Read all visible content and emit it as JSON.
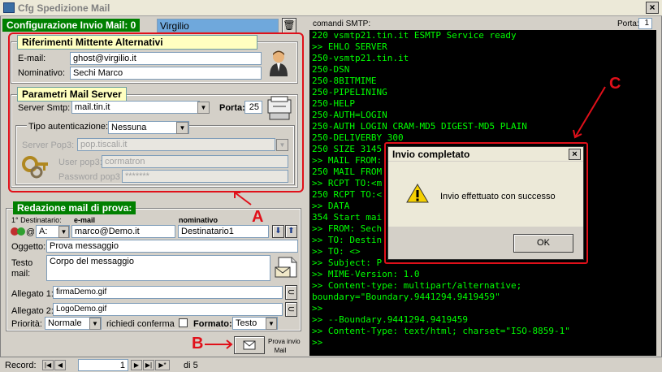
{
  "window": {
    "title": "Cfg Spedizione Mail",
    "close": "×"
  },
  "config": {
    "label": "Configurazione Invio Mail: 0",
    "name": "Virgilio"
  },
  "sender": {
    "header": "Riferimenti Mittente Alternativi",
    "email_label": "E-mail:",
    "email": "ghost@virgilio.it",
    "name_label": "Nominativo:",
    "name": "Sechi Marco"
  },
  "server": {
    "header": "Parametri Mail Server",
    "smtp_label": "Server Smtp:",
    "smtp": "mail.tin.it",
    "port_label": "Porta:",
    "port": "25",
    "auth_label": "Tipo autenticazione:",
    "auth": "Nessuna",
    "pop3_label": "Server Pop3:",
    "pop3": "pop.tiscali.it",
    "user_label": "User pop3:",
    "user": "cormatron",
    "pwd_label": "Password pop3",
    "pwd": "*******"
  },
  "compose": {
    "header": "Redazione mail di prova:",
    "dest_label": "1° Destinatario:",
    "email_col": "e-mail",
    "name_col": "nominativo",
    "type": "A:",
    "to": "marco@Demo.it",
    "to_name": "Destinatario1",
    "subject_label": "Oggetto:",
    "subject": "Prova messaggio",
    "body_label1": "Testo",
    "body_label2": "mail:",
    "body": "Corpo del messaggio",
    "att1_label": "Allegato 1:",
    "att1": "firmaDemo.gif",
    "att2_label": "Allegato 2:",
    "att2": "LogoDemo.gif",
    "priority_label": "Priorità:",
    "priority": "Normale",
    "confirm_label": "richiedi conferma",
    "format_label": "Formato:",
    "format": "Testo",
    "send_label1": "Prova invio",
    "send_label2": "Mail"
  },
  "record": {
    "label": "Record:",
    "current": "1",
    "total": "di 5"
  },
  "smtp_log": {
    "label": "comandi SMTP:",
    "port_label": "Porta:",
    "port": "1",
    "lines": [
      "220 vsmtp21.tin.it ESMTP Service ready",
      ">> EHLO SERVER",
      "250-vsmtp21.tin.it",
      "250-DSN",
      "250-8BITMIME",
      "250-PIPELINING",
      "250-HELP",
      "250-AUTH=LOGIN",
      "250-AUTH LOGIN CRAM-MD5 DIGEST-MD5 PLAIN",
      "250-DELIVERBY 300",
      "250 SIZE 3145",
      ">> MAIL FROM:",
      "250 MAIL FROM",
      ">> RCPT TO:<m",
      "250 RCPT TO:<",
      ">> DATA",
      "354 Start mai",
      ">> FROM: Sech",
      ">> TO: Destin",
      ">> TO:  <>",
      ">> Subject: P",
      ">> MIME-Version: 1.0",
      ">> Content-type: multipart/alternative;",
      "boundary=\"Boundary.9441294.9419459\"",
      ">>",
      ">> --Boundary.9441294.9419459",
      ">> Content-Type: text/html; charset=\"ISO-8859-1\"",
      ">>"
    ]
  },
  "dialog": {
    "title": "Invio completato",
    "message": "Invio effettuato con successo",
    "ok": "OK"
  },
  "annotations": {
    "a": "A",
    "b": "B",
    "c": "C"
  },
  "colors": {
    "annotation": "#e0101a",
    "console_bg": "#000000",
    "console_text": "#00ff00",
    "header_green": "#008000",
    "header_yellow": "#ffffc0"
  }
}
